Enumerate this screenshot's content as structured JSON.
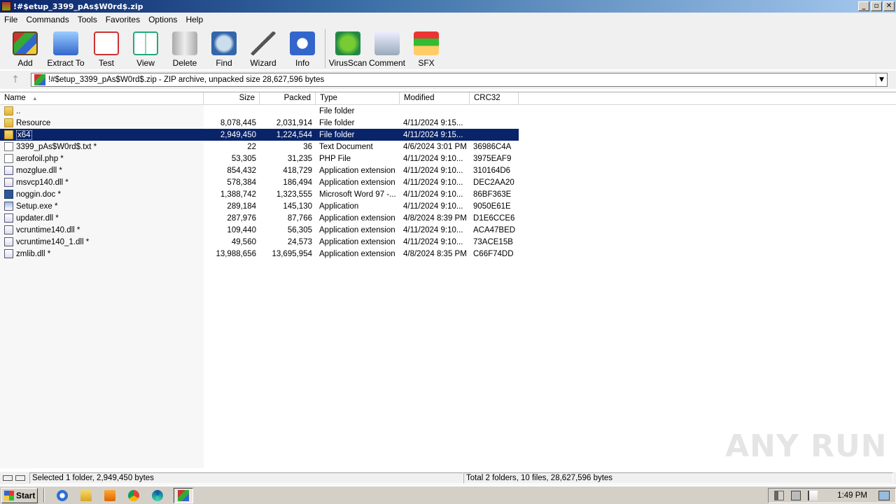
{
  "window": {
    "title": "!#$etup_3399_pAs$W0rd$.zip",
    "controls": [
      "_",
      "▫",
      "✕"
    ]
  },
  "menu": [
    "File",
    "Commands",
    "Tools",
    "Favorites",
    "Options",
    "Help"
  ],
  "toolbar": [
    {
      "label": "Add",
      "icon": "add-archive-icon"
    },
    {
      "label": "Extract To",
      "icon": "extract-folder-icon"
    },
    {
      "label": "Test",
      "icon": "test-checklist-icon"
    },
    {
      "label": "View",
      "icon": "view-book-icon"
    },
    {
      "label": "Delete",
      "icon": "trash-icon"
    },
    {
      "label": "Find",
      "icon": "magnifier-icon"
    },
    {
      "label": "Wizard",
      "icon": "wand-icon"
    },
    {
      "label": "Info",
      "icon": "info-icon"
    },
    {
      "label": "VirusScan",
      "icon": "bug-icon"
    },
    {
      "label": "Comment",
      "icon": "comment-icon"
    },
    {
      "label": "SFX",
      "icon": "sfx-box-icon"
    }
  ],
  "address": {
    "text": "!#$etup_3399_pAs$W0rd$.zip - ZIP archive, unpacked size 28,627,596 bytes"
  },
  "columns": [
    "Name",
    "Size",
    "Packed",
    "Type",
    "Modified",
    "CRC32"
  ],
  "rows": [
    {
      "name": "..",
      "size": "",
      "packed": "",
      "type": "File folder",
      "modified": "",
      "crc": "",
      "icon": "folder"
    },
    {
      "name": "Resource",
      "size": "8,078,445",
      "packed": "2,031,914",
      "type": "File folder",
      "modified": "4/11/2024 9:15...",
      "crc": "",
      "icon": "folder"
    },
    {
      "name": "x64",
      "size": "2,949,450",
      "packed": "1,224,544",
      "type": "File folder",
      "modified": "4/11/2024 9:15...",
      "crc": "",
      "icon": "folder",
      "selected": true
    },
    {
      "name": "3399_pAs$W0rd$.txt *",
      "size": "22",
      "packed": "36",
      "type": "Text Document",
      "modified": "4/6/2024 3:01 PM",
      "crc": "36986C4A",
      "icon": "doc"
    },
    {
      "name": "aerofoil.php *",
      "size": "53,305",
      "packed": "31,235",
      "type": "PHP File",
      "modified": "4/11/2024 9:10...",
      "crc": "3975EAF9",
      "icon": "doc"
    },
    {
      "name": "mozglue.dll *",
      "size": "854,432",
      "packed": "418,729",
      "type": "Application extension",
      "modified": "4/11/2024 9:10...",
      "crc": "310164D6",
      "icon": "dll"
    },
    {
      "name": "msvcp140.dll *",
      "size": "578,384",
      "packed": "186,494",
      "type": "Application extension",
      "modified": "4/11/2024 9:10...",
      "crc": "DEC2AA20",
      "icon": "dll"
    },
    {
      "name": "noggin.doc *",
      "size": "1,388,742",
      "packed": "1,323,555",
      "type": "Microsoft Word 97 -...",
      "modified": "4/11/2024 9:10...",
      "crc": "86BF363E",
      "icon": "word"
    },
    {
      "name": "Setup.exe *",
      "size": "289,184",
      "packed": "145,130",
      "type": "Application",
      "modified": "4/11/2024 9:10...",
      "crc": "9050E61E",
      "icon": "exe"
    },
    {
      "name": "updater.dll *",
      "size": "287,976",
      "packed": "87,766",
      "type": "Application extension",
      "modified": "4/8/2024 8:39 PM",
      "crc": "D1E6CCE6",
      "icon": "dll"
    },
    {
      "name": "vcruntime140.dll *",
      "size": "109,440",
      "packed": "56,305",
      "type": "Application extension",
      "modified": "4/11/2024 9:10...",
      "crc": "ACA47BED",
      "icon": "dll"
    },
    {
      "name": "vcruntime140_1.dll *",
      "size": "49,560",
      "packed": "24,573",
      "type": "Application extension",
      "modified": "4/11/2024 9:10...",
      "crc": "73ACE15B",
      "icon": "dll"
    },
    {
      "name": "zmlib.dll *",
      "size": "13,988,656",
      "packed": "13,695,954",
      "type": "Application extension",
      "modified": "4/8/2024 8:35 PM",
      "crc": "C66F74DD",
      "icon": "dll"
    }
  ],
  "status": {
    "left": "Selected 1 folder, 2,949,450 bytes",
    "right": "Total 2 folders, 10 files, 28,627,596 bytes"
  },
  "taskbar": {
    "start_label": "Start",
    "clock": "1:49 PM"
  },
  "watermark": "ANY RUN",
  "colors": {
    "selection": "#0a246a",
    "titlebar": "#0a246a"
  }
}
